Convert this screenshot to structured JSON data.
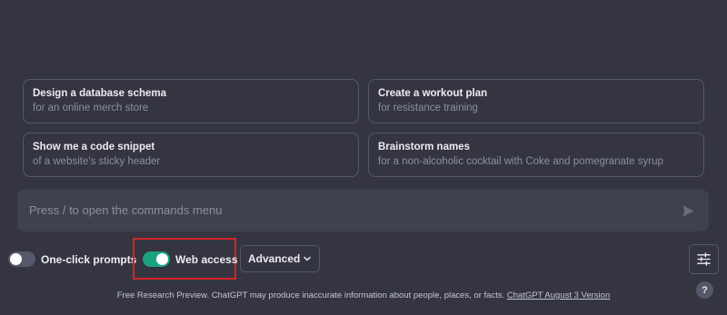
{
  "suggestions": [
    {
      "title": "Design a database schema",
      "subtitle": "for an online merch store"
    },
    {
      "title": "Create a workout plan",
      "subtitle": "for resistance training"
    },
    {
      "title": "Show me a code snippet",
      "subtitle": "of a website's sticky header"
    },
    {
      "title": "Brainstorm names",
      "subtitle": "for a non-alcoholic cocktail with Coke and pomegranate syrup"
    }
  ],
  "composer": {
    "placeholder": "Press / to open the commands menu",
    "send_icon": "send-arrow-icon"
  },
  "toggles": {
    "one_click": {
      "label": "One-click prompts",
      "enabled": false
    },
    "web_access": {
      "label": "Web access",
      "enabled": true
    }
  },
  "advanced": {
    "label": "Advanced",
    "icon": "chevron-down-icon"
  },
  "settings": {
    "icon": "sliders-icon"
  },
  "footer": {
    "text": "Free Research Preview. ChatGPT may produce inaccurate information about people, places, or facts. ",
    "link": "ChatGPT August 3 Version"
  },
  "help": {
    "label": "?"
  },
  "colors": {
    "background": "#343541",
    "card_border": "#565869",
    "composer_bg": "#40414f",
    "toggle_on": "#19a37f",
    "highlight": "#d3242a"
  }
}
